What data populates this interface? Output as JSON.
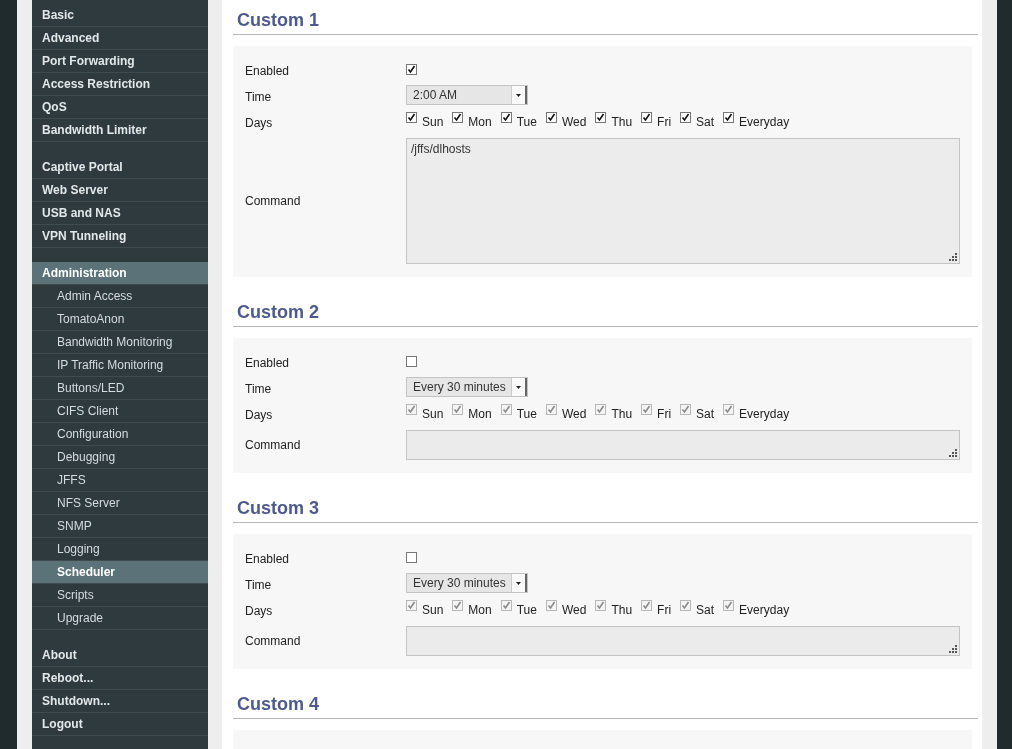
{
  "sidebar": {
    "groups": [
      {
        "items": [
          {
            "label": "Basic",
            "selected": false
          },
          {
            "label": "Advanced",
            "selected": false
          },
          {
            "label": "Port Forwarding",
            "selected": false
          },
          {
            "label": "Access Restriction",
            "selected": false
          },
          {
            "label": "QoS",
            "selected": false
          },
          {
            "label": "Bandwidth Limiter",
            "selected": false
          }
        ]
      },
      {
        "items": [
          {
            "label": "Captive Portal",
            "selected": false
          },
          {
            "label": "Web Server",
            "selected": false
          },
          {
            "label": "USB and NAS",
            "selected": false
          },
          {
            "label": "VPN Tunneling",
            "selected": false
          }
        ]
      },
      {
        "items": [
          {
            "label": "Administration",
            "selected": true,
            "children": [
              {
                "label": "Admin Access",
                "selected": false
              },
              {
                "label": "TomatoAnon",
                "selected": false
              },
              {
                "label": "Bandwidth Monitoring",
                "selected": false
              },
              {
                "label": "IP Traffic Monitoring",
                "selected": false
              },
              {
                "label": "Buttons/LED",
                "selected": false
              },
              {
                "label": "CIFS Client",
                "selected": false
              },
              {
                "label": "Configuration",
                "selected": false
              },
              {
                "label": "Debugging",
                "selected": false
              },
              {
                "label": "JFFS",
                "selected": false
              },
              {
                "label": "NFS Server",
                "selected": false
              },
              {
                "label": "SNMP",
                "selected": false
              },
              {
                "label": "Logging",
                "selected": false
              },
              {
                "label": "Scheduler",
                "selected": true
              },
              {
                "label": "Scripts",
                "selected": false
              },
              {
                "label": "Upgrade",
                "selected": false
              }
            ]
          }
        ]
      },
      {
        "items": [
          {
            "label": "About",
            "selected": false
          },
          {
            "label": "Reboot...",
            "selected": false
          },
          {
            "label": "Shutdown...",
            "selected": false
          },
          {
            "label": "Logout",
            "selected": false
          }
        ]
      }
    ]
  },
  "sections": [
    {
      "title": "Custom 1",
      "labels": {
        "enabled": "Enabled",
        "time": "Time",
        "days": "Days",
        "command": "Command"
      },
      "enabled": true,
      "time": "2:00 AM",
      "days": [
        {
          "label": "Sun",
          "checked": true
        },
        {
          "label": "Mon",
          "checked": true
        },
        {
          "label": "Tue",
          "checked": true
        },
        {
          "label": "Wed",
          "checked": true
        },
        {
          "label": "Thu",
          "checked": true
        },
        {
          "label": "Fri",
          "checked": true
        },
        {
          "label": "Sat",
          "checked": true
        },
        {
          "label": "Everyday",
          "checked": true
        }
      ],
      "command": "/jffs/dlhosts"
    },
    {
      "title": "Custom 2",
      "labels": {
        "enabled": "Enabled",
        "time": "Time",
        "days": "Days",
        "command": "Command"
      },
      "enabled": false,
      "time": "Every 30 minutes",
      "days": [
        {
          "label": "Sun",
          "checked": true
        },
        {
          "label": "Mon",
          "checked": true
        },
        {
          "label": "Tue",
          "checked": true
        },
        {
          "label": "Wed",
          "checked": true
        },
        {
          "label": "Thu",
          "checked": true
        },
        {
          "label": "Fri",
          "checked": true
        },
        {
          "label": "Sat",
          "checked": true
        },
        {
          "label": "Everyday",
          "checked": true
        }
      ]
    },
    {
      "title": "Custom 3",
      "labels": {
        "enabled": "Enabled",
        "time": "Time",
        "days": "Days",
        "command": "Command"
      },
      "enabled": false,
      "time": "Every 30 minutes",
      "days": [
        {
          "label": "Sun",
          "checked": true
        },
        {
          "label": "Mon",
          "checked": true
        },
        {
          "label": "Tue",
          "checked": true
        },
        {
          "label": "Wed",
          "checked": true
        },
        {
          "label": "Thu",
          "checked": true
        },
        {
          "label": "Fri",
          "checked": true
        },
        {
          "label": "Sat",
          "checked": true
        },
        {
          "label": "Everyday",
          "checked": true
        }
      ]
    },
    {
      "title": "Custom 4"
    }
  ]
}
